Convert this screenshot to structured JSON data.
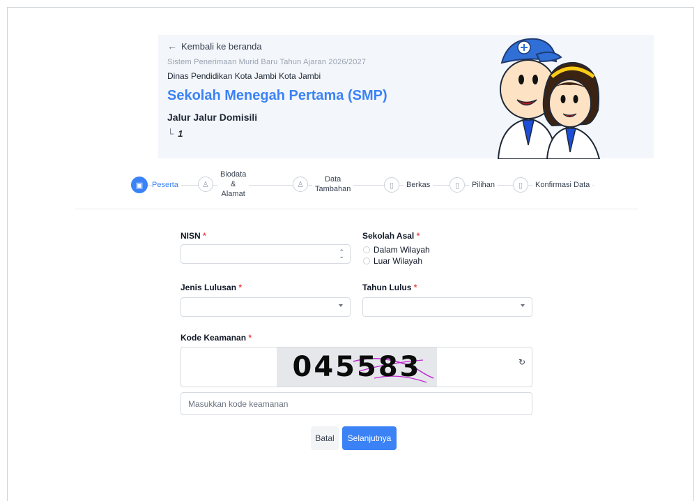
{
  "header": {
    "back_link": "Kembali ke beranda",
    "period": "Sistem Penerimaan Murid Baru  Tahun Ajaran 2026/2027",
    "agency": "Dinas Pendidikan Kota Jambi Kota Jambi",
    "level": "Sekolah Menegah Pertama (SMP)",
    "route": "Jalur Jalur Domisili",
    "sub_number": "1"
  },
  "stepper": {
    "active_index": 0,
    "steps": [
      {
        "label": "Peserta",
        "icon": "badge-icon"
      },
      {
        "label": "Biodata & Alamat",
        "label_lines": [
          "Biodata",
          "&",
          "Alamat"
        ],
        "icon": "user-icon"
      },
      {
        "label": "Data Tambahan",
        "label_lines": [
          "Data",
          "Tambahan"
        ],
        "icon": "user-icon"
      },
      {
        "label": "Berkas",
        "icon": "file-icon"
      },
      {
        "label": "Pilihan",
        "icon": "file-icon"
      },
      {
        "label": "Konfirmasi Data",
        "icon": "file-icon"
      }
    ]
  },
  "form": {
    "nisn": {
      "label": "NISN",
      "value": ""
    },
    "sekolah_asal": {
      "label": "Sekolah Asal",
      "options": [
        "Dalam Wilayah",
        "Luar Wilayah"
      ],
      "selected": null
    },
    "jenis_lulusan": {
      "label": "Jenis Lulusan",
      "value": ""
    },
    "tahun_lulus": {
      "label": "Tahun Lulus",
      "value": ""
    },
    "kode_keamanan": {
      "label": "Kode Keamanan",
      "captcha_text": "045583",
      "placeholder": "Masukkan kode keamanan",
      "value": ""
    },
    "required_marker": "*"
  },
  "buttons": {
    "cancel": "Batal",
    "next": "Selanjutnya"
  },
  "colors": {
    "accent": "#3b82f6",
    "required": "#ef4444",
    "banner_bg": "#f3f6fa"
  }
}
